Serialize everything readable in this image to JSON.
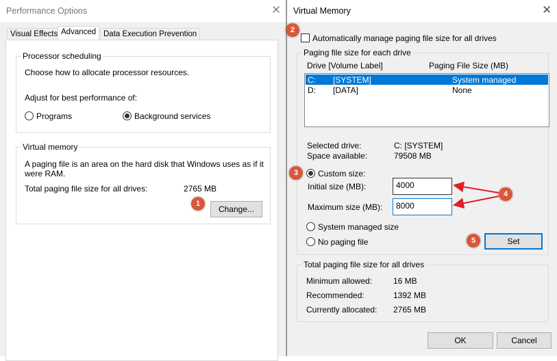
{
  "perf": {
    "title": "Performance Options",
    "tabs": [
      "Visual Effects",
      "Advanced",
      "Data Execution Prevention"
    ],
    "proc": {
      "label": "Processor scheduling",
      "desc": "Choose how to allocate processor resources.",
      "adjust": "Adjust for best performance of:",
      "programs": "Programs",
      "background": "Background services",
      "selected": "Background services"
    },
    "vm": {
      "label": "Virtual memory",
      "desc": "A paging file is an area on the hard disk that Windows uses as if it were RAM.",
      "total_label": "Total paging file size for all drives:",
      "total_value": "2765 MB",
      "change": "Change..."
    }
  },
  "vmdlg": {
    "title": "Virtual Memory",
    "auto_label": "Automatically manage paging file size for all drives",
    "auto_checked": false,
    "group_label": "Paging file size for each drive",
    "col_drive": "Drive  [Volume Label]",
    "col_size": "Paging File Size (MB)",
    "drives": [
      {
        "drive": "C:",
        "label": "[SYSTEM]",
        "size": "System managed",
        "selected": true
      },
      {
        "drive": "D:",
        "label": "[DATA]",
        "size": "None",
        "selected": false
      }
    ],
    "selected_drive_label": "Selected drive:",
    "selected_drive_value": "C:  [SYSTEM]",
    "space_label": "Space available:",
    "space_value": "79508 MB",
    "custom": "Custom size:",
    "initial_label": "Initial size (MB):",
    "initial_value": "4000",
    "max_label": "Maximum size (MB):",
    "max_value": "8000",
    "system_managed": "System managed size",
    "no_paging": "No paging file",
    "set": "Set",
    "total_group": "Total paging file size for all drives",
    "min_label": "Minimum allowed:",
    "min_value": "16 MB",
    "rec_label": "Recommended:",
    "rec_value": "1392 MB",
    "cur_label": "Currently allocated:",
    "cur_value": "2765 MB",
    "ok": "OK",
    "cancel": "Cancel"
  },
  "badges": [
    "1",
    "2",
    "3",
    "4",
    "5"
  ],
  "colors": {
    "badge": "#d9573a",
    "selection": "#0078d7",
    "arrow": "#e01f26"
  }
}
